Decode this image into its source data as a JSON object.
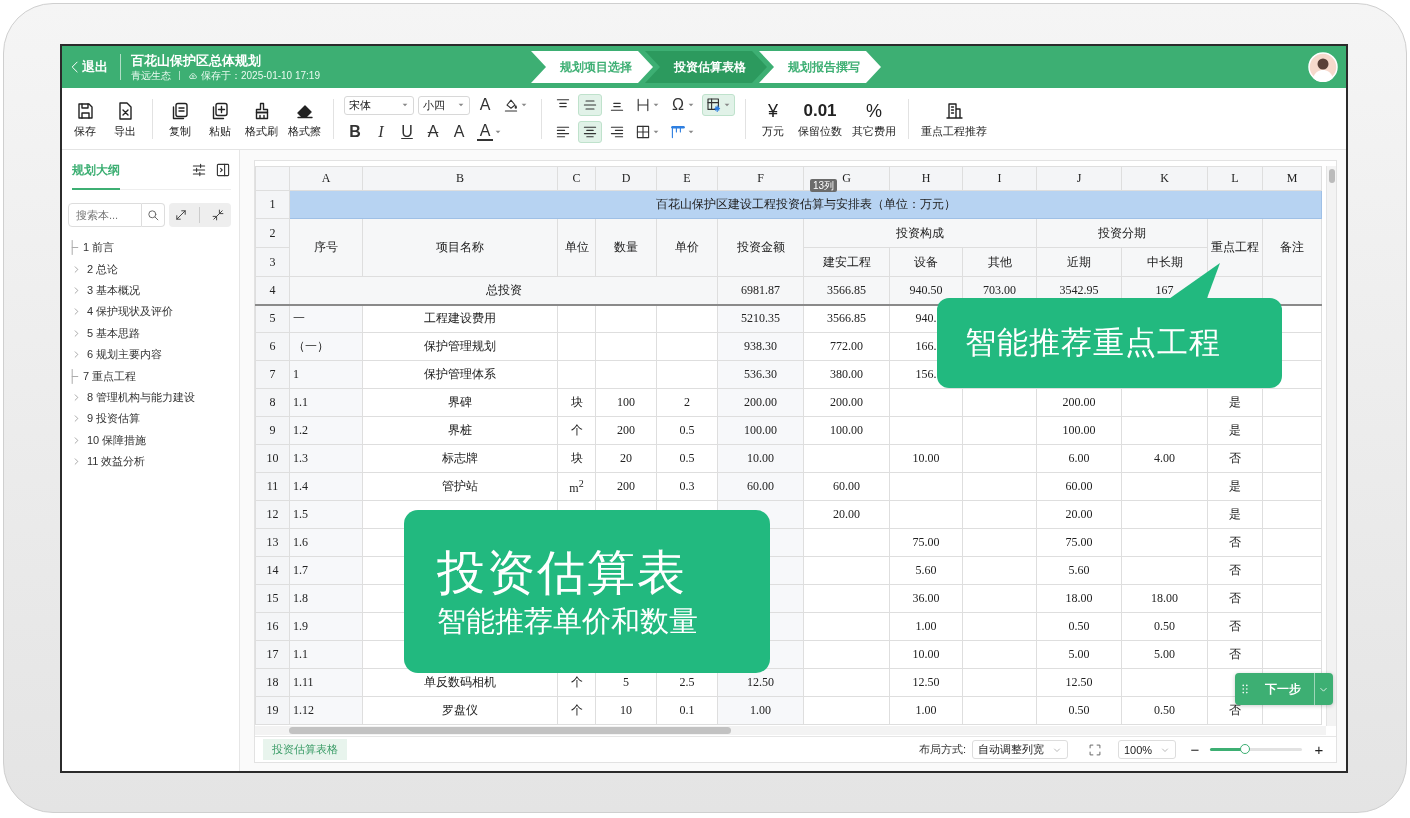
{
  "header": {
    "exit_label": "退出",
    "title": "百花山保护区总体规划",
    "organization": "青远生态",
    "save_status": "保存于：2025-01-10 17:19",
    "steps": [
      {
        "label": "规划项目选择",
        "selected": false
      },
      {
        "label": "投资估算表格",
        "selected": true
      },
      {
        "label": "规划报告撰写",
        "selected": false
      }
    ]
  },
  "toolbar": {
    "file_tools": [
      {
        "kind": "save",
        "label": "保存"
      },
      {
        "kind": "export",
        "label": "导出"
      }
    ],
    "edit_tools": [
      {
        "kind": "copy",
        "label": "复制"
      },
      {
        "kind": "paste",
        "label": "粘贴"
      },
      {
        "kind": "format-painter",
        "label": "格式刷"
      },
      {
        "kind": "clear-format",
        "label": "格式擦"
      }
    ],
    "font": {
      "family": "宋体",
      "size": "小四"
    },
    "font_tools_top": [
      {
        "kind": "grow",
        "glyph": "A",
        "dropdown": false
      },
      {
        "kind": "fill",
        "dropdown": true
      }
    ],
    "font_tools_bottom": [
      {
        "kind": "bold",
        "glyph": "B",
        "dropdown": false
      },
      {
        "kind": "italic",
        "glyph": "I",
        "dropdown": false
      },
      {
        "kind": "underline",
        "glyph": "U",
        "dropdown": false
      },
      {
        "kind": "strike",
        "glyph": "A",
        "dropdown": false
      },
      {
        "kind": "superscript",
        "glyph": "A",
        "dropdown": false
      },
      {
        "kind": "color",
        "glyph": "A",
        "dropdown": true
      }
    ],
    "align_tools_top": [
      {
        "kind": "top",
        "selected": false,
        "dropdown": false
      },
      {
        "kind": "middle",
        "selected": true,
        "dropdown": false
      },
      {
        "kind": "bottom",
        "selected": false,
        "dropdown": false
      },
      {
        "kind": "row-height",
        "selected": false,
        "dropdown": true
      },
      {
        "kind": "symbol",
        "glyph": "Ω",
        "selected": false,
        "dropdown": true
      },
      {
        "kind": "freeze",
        "selected": true,
        "dropdown": true
      }
    ],
    "align_tools_bottom": [
      {
        "kind": "left",
        "selected": false,
        "dropdown": false
      },
      {
        "kind": "center",
        "selected": true,
        "dropdown": false
      },
      {
        "kind": "right",
        "selected": false,
        "dropdown": false
      },
      {
        "kind": "borders",
        "selected": false,
        "dropdown": true
      },
      {
        "kind": "merge",
        "selected": false,
        "dropdown": true
      }
    ],
    "number_tools": [
      {
        "kind": "yuan",
        "glyph": "¥",
        "label": "万元"
      },
      {
        "kind": "decimals",
        "glyph": "0.01",
        "label": "保留位数"
      },
      {
        "kind": "percent",
        "glyph": "%",
        "label": "其它费用"
      }
    ],
    "recommend_tool": {
      "label": "重点工程推荐"
    }
  },
  "outline": {
    "tab": {
      "label": "规划大纲",
      "selected": true
    },
    "search_placeholder": "搜索本...",
    "items": [
      {
        "label": "1 前言",
        "expandable": false
      },
      {
        "label": "2 总论",
        "expandable": true
      },
      {
        "label": "3 基本概况",
        "expandable": true
      },
      {
        "label": "4 保护现状及评价",
        "expandable": true
      },
      {
        "label": "5 基本思路",
        "expandable": true
      },
      {
        "label": "6 规划主要内容",
        "expandable": true
      },
      {
        "label": "7 重点工程",
        "expandable": false
      },
      {
        "label": "8 管理机构与能力建设",
        "expandable": true
      },
      {
        "label": "9 投资估算",
        "expandable": true
      },
      {
        "label": "10 保障措施",
        "expandable": true
      },
      {
        "label": "11 效益分析",
        "expandable": true
      }
    ]
  },
  "table": {
    "columns": [
      "A",
      "B",
      "C",
      "D",
      "E",
      "F",
      "G",
      "H",
      "I",
      "J",
      "K",
      "L",
      "M"
    ],
    "column_tooltip": "13列",
    "header_rows": [
      {
        "number": "1",
        "kind": "title",
        "cells": [
          {
            "text": "百花山保护区建设工程投资估算与安排表（单位：万元）",
            "colspan": 13
          }
        ]
      },
      {
        "number": "2",
        "kind": "head",
        "cells": [
          {
            "text": "序号",
            "rowspan": 2
          },
          {
            "text": "项目名称",
            "rowspan": 2
          },
          {
            "text": "单位",
            "rowspan": 2
          },
          {
            "text": "数量",
            "rowspan": 2
          },
          {
            "text": "单价",
            "rowspan": 2
          },
          {
            "text": "投资金额",
            "rowspan": 2
          },
          {
            "text": "投资构成",
            "colspan": 3
          },
          {
            "text": "投资分期",
            "colspan": 2
          },
          {
            "text": "重点工程",
            "rowspan": 2
          },
          {
            "text": "备注",
            "rowspan": 2
          }
        ]
      },
      {
        "number": "3",
        "kind": "head",
        "cells": [
          {
            "text": "建安工程"
          },
          {
            "text": "设备"
          },
          {
            "text": "其他"
          },
          {
            "text": "近期"
          },
          {
            "text": "中长期"
          }
        ]
      },
      {
        "number": "4",
        "kind": "total",
        "cells": [
          {
            "text": "总投资",
            "colspan": 5
          },
          {
            "text": "6981.87"
          },
          {
            "text": "3566.85"
          },
          {
            "text": "940.50"
          },
          {
            "text": "703.00"
          },
          {
            "text": "3542.95"
          },
          {
            "text": "167"
          },
          null,
          null
        ]
      }
    ],
    "rows": [
      {
        "number": "5",
        "cells": [
          "一",
          "工程建设费用",
          null,
          null,
          null,
          "5210.35",
          "3566.85",
          "940.",
          null,
          null,
          null,
          null,
          null
        ]
      },
      {
        "number": "6",
        "cells": [
          "（一）",
          "保护管理规划",
          null,
          null,
          null,
          "938.30",
          "772.00",
          "166.",
          null,
          null,
          null,
          null,
          null
        ]
      },
      {
        "number": "7",
        "cells": [
          "1",
          "保护管理体系",
          null,
          null,
          null,
          "536.30",
          "380.00",
          "156.",
          null,
          null,
          null,
          null,
          null
        ]
      },
      {
        "number": "8",
        "cells": [
          "1.1",
          "界碑",
          "块",
          "100",
          "2",
          "200.00",
          "200.00",
          null,
          null,
          "200.00",
          null,
          "是",
          null
        ]
      },
      {
        "number": "9",
        "cells": [
          "1.2",
          "界桩",
          "个",
          "200",
          "0.5",
          "100.00",
          "100.00",
          null,
          null,
          "100.00",
          null,
          "是",
          null
        ]
      },
      {
        "number": "10",
        "cells": [
          "1.3",
          "标志牌",
          "块",
          "20",
          "0.5",
          "10.00",
          null,
          "10.00",
          null,
          "6.00",
          "4.00",
          "否",
          null
        ]
      },
      {
        "number": "11",
        "cells": [
          "1.4",
          "管护站",
          "m$^{2}$",
          "200",
          "0.3",
          "60.00",
          "60.00",
          null,
          null,
          "60.00",
          null,
          "是",
          null
        ]
      },
      {
        "number": "12",
        "cells": [
          "1.5",
          null,
          null,
          null,
          null,
          null,
          "20.00",
          null,
          null,
          "20.00",
          null,
          "是",
          null
        ]
      },
      {
        "number": "13",
        "cells": [
          "1.6",
          null,
          null,
          null,
          null,
          null,
          null,
          "75.00",
          null,
          "75.00",
          null,
          "否",
          null
        ]
      },
      {
        "number": "14",
        "cells": [
          "1.7",
          null,
          null,
          null,
          null,
          null,
          null,
          "5.60",
          null,
          "5.60",
          null,
          "否",
          null
        ]
      },
      {
        "number": "15",
        "cells": [
          "1.8",
          null,
          null,
          null,
          null,
          null,
          null,
          "36.00",
          null,
          "18.00",
          "18.00",
          "否",
          null
        ]
      },
      {
        "number": "16",
        "cells": [
          "1.9",
          null,
          null,
          null,
          null,
          null,
          null,
          "1.00",
          null,
          "0.50",
          "0.50",
          "否",
          null
        ]
      },
      {
        "number": "17",
        "cells": [
          "1.1",
          null,
          null,
          null,
          null,
          null,
          null,
          "10.00",
          null,
          "5.00",
          "5.00",
          "否",
          null
        ]
      },
      {
        "number": "18",
        "cells": [
          "1.11",
          "单反数码相机",
          "个",
          "5",
          "2.5",
          "12.50",
          null,
          "12.50",
          null,
          "12.50",
          null,
          null,
          null
        ]
      },
      {
        "number": "19",
        "cells": [
          "1.12",
          "罗盘仪",
          "个",
          "10",
          "0.1",
          "1.00",
          null,
          "1.00",
          null,
          "0.50",
          "0.50",
          "否",
          null
        ]
      }
    ]
  },
  "bottom_bar": {
    "sheet_tabs": [
      {
        "label": "投资估算表格",
        "selected": true
      }
    ],
    "layout_label": "布局方式:",
    "layout_value": "自动调整列宽",
    "zoom_value": "100%",
    "zoom_out": "−",
    "zoom_in": "+",
    "zoom_level": {
      "level": 0.38
    }
  },
  "callouts": [
    {
      "kind": "pointer",
      "title": "智能推荐重点工程"
    },
    {
      "kind": "panel",
      "title": "投资估算表",
      "subtitle": "智能推荐单价和数量"
    }
  ],
  "next_button": {
    "label": "下一步"
  }
}
